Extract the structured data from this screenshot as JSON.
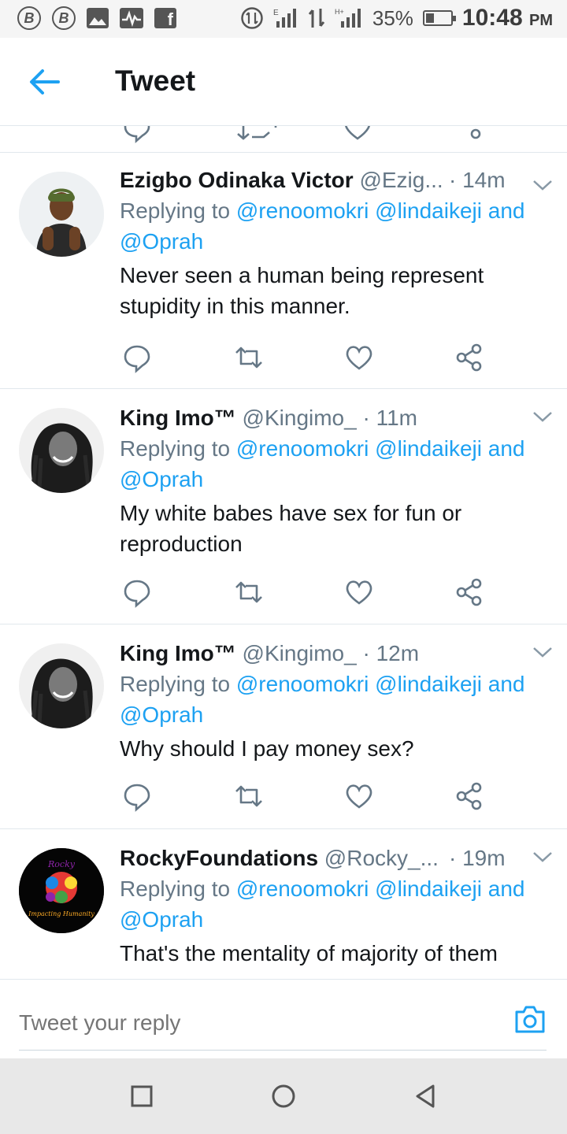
{
  "status_bar": {
    "left_icons": [
      "b-badge-icon",
      "b-badge-icon",
      "image-icon",
      "pulse-icon",
      "facebook-icon"
    ],
    "right_icons": [
      "data-icon",
      "signal-icon",
      "transfer-icon",
      "signal-icon"
    ],
    "sim1_label": "E",
    "sim2_label": "H+",
    "battery": "35%",
    "battery_level": 0.35,
    "time": "10:48",
    "ampm": "PM"
  },
  "header": {
    "title": "Tweet"
  },
  "tweets": [
    {
      "name": "Ezigbo Odinaka Victor",
      "handle": "@Ezig...",
      "time": "· 14m",
      "replying_prefix": "Replying to",
      "mentions": [
        "@renoomokri",
        "@lindaikeji"
      ],
      "and": "and",
      "last_mention": "@Oprah",
      "text": "Never seen a human being represent stupidity in this manner."
    },
    {
      "name": "King Imo™",
      "handle": "@Kingimo_",
      "time": "· 11m",
      "replying_prefix": "Replying to",
      "mentions": [
        "@renoomokri",
        "@lindaikeji"
      ],
      "and": "and",
      "last_mention": "@Oprah",
      "text": "My white babes have sex for fun or reproduction"
    },
    {
      "name": "King Imo™",
      "handle": "@Kingimo_",
      "time": "· 12m",
      "replying_prefix": "Replying to",
      "mentions": [
        "@renoomokri",
        "@lindaikeji"
      ],
      "and": "and",
      "last_mention": "@Oprah",
      "text": "Why should I pay money sex?"
    },
    {
      "name": "RockyFoundations",
      "handle": "@Rocky_...",
      "time": "· 19m",
      "replying_prefix": "Replying to",
      "mentions": [
        "@renoomokri",
        "@lindaikeji"
      ],
      "and": "and",
      "last_mention": "@Oprah",
      "text": "That's the mentality of majority of them",
      "avatar_text_top": "Rocky",
      "avatar_text_bottom": "Impacting Humanity"
    }
  ],
  "composer": {
    "placeholder": "Tweet your reply"
  },
  "colors": {
    "accent": "#1da1f2",
    "secondary_text": "#657786",
    "primary_text": "#14171a",
    "divider": "#e1e8ed"
  }
}
